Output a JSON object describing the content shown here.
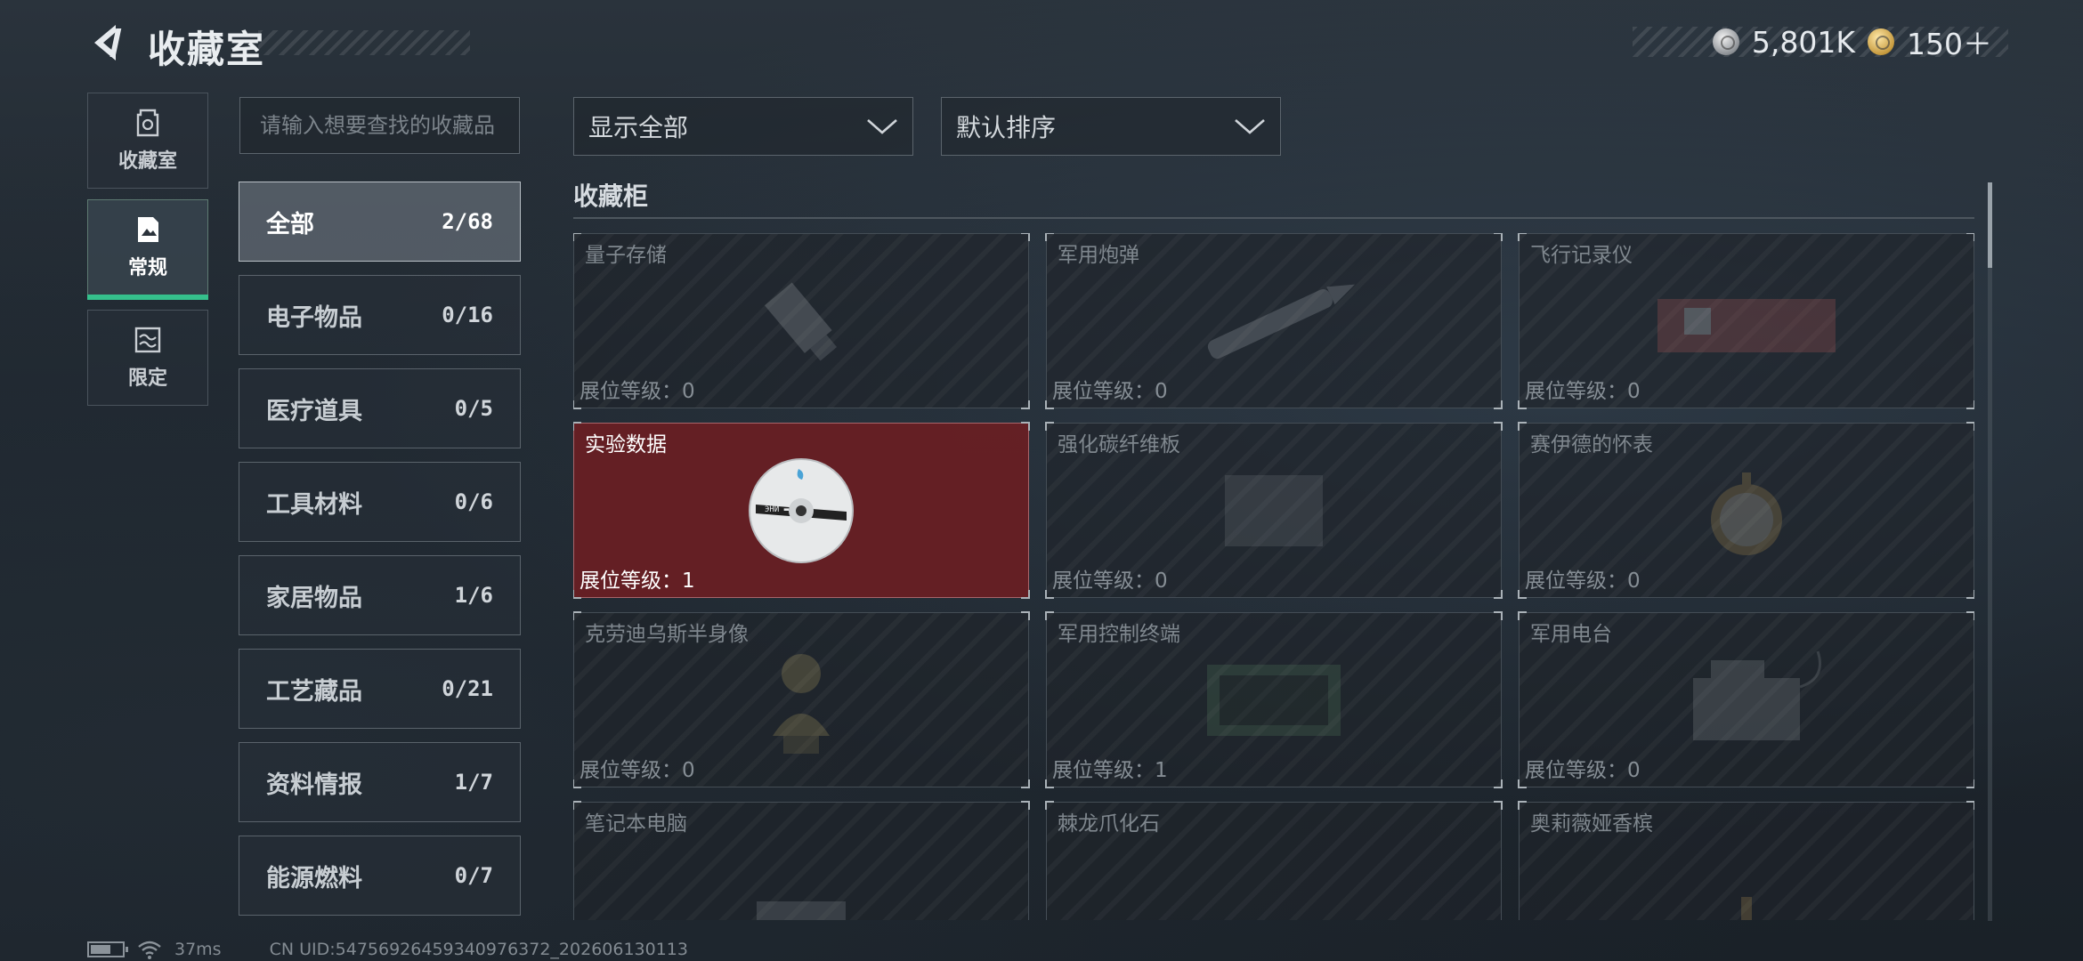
{
  "header": {
    "title": "收藏室",
    "currencies": [
      {
        "icon": "silver-coin-icon",
        "value": "5,801K"
      },
      {
        "icon": "gold-coin-icon",
        "value": "150＋"
      }
    ]
  },
  "side_nav": {
    "items": [
      {
        "label": "收藏室",
        "icon": "vault-icon",
        "active": false
      },
      {
        "label": "常规",
        "icon": "document-icon",
        "active": true
      },
      {
        "label": "限定",
        "icon": "limited-icon",
        "active": false
      }
    ]
  },
  "search": {
    "placeholder": "请输入想要查找的收藏品",
    "value": ""
  },
  "categories": [
    {
      "name": "全部",
      "count": "2/68",
      "active": true
    },
    {
      "name": "电子物品",
      "count": "0/16"
    },
    {
      "name": "医疗道具",
      "count": "0/5"
    },
    {
      "name": "工具材料",
      "count": "0/6"
    },
    {
      "name": "家居物品",
      "count": "1/6"
    },
    {
      "name": "工艺藏品",
      "count": "0/21"
    },
    {
      "name": "资料情报",
      "count": "1/7"
    },
    {
      "name": "能源燃料",
      "count": "0/7"
    }
  ],
  "filters": {
    "display": "显示全部",
    "sort": "默认排序"
  },
  "section": {
    "title": "收藏柜"
  },
  "items": [
    {
      "name": "量子存储",
      "level": "展位等级：0",
      "icon": "usb-drive-icon"
    },
    {
      "name": "军用炮弹",
      "level": "展位等级：0",
      "icon": "artillery-shell-icon"
    },
    {
      "name": "飞行记录仪",
      "level": "展位等级：0",
      "icon": "flight-recorder-icon"
    },
    {
      "name": "实验数据",
      "level": "展位等级：1",
      "icon": "disc-icon",
      "owned": true
    },
    {
      "name": "强化碳纤维板",
      "level": "展位等级：0",
      "icon": "carbon-plate-icon"
    },
    {
      "name": "赛伊德的怀表",
      "level": "展位等级：0",
      "icon": "pocket-watch-icon"
    },
    {
      "name": "克劳迪乌斯半身像",
      "level": "展位等级：0",
      "icon": "bust-icon"
    },
    {
      "name": "军用控制终端",
      "level": "展位等级：1",
      "icon": "control-terminal-icon"
    },
    {
      "name": "军用电台",
      "level": "展位等级：0",
      "icon": "radio-icon"
    },
    {
      "name": "笔记本电脑",
      "level": "",
      "icon": "laptop-icon"
    },
    {
      "name": "棘龙爪化石",
      "level": "",
      "icon": "fossil-icon"
    },
    {
      "name": "奥莉薇娅香槟",
      "level": "",
      "icon": "champagne-icon"
    }
  ],
  "footer": {
    "ping": "37ms",
    "uid": "CN UID:5475692645934097637​2_202606130113"
  }
}
